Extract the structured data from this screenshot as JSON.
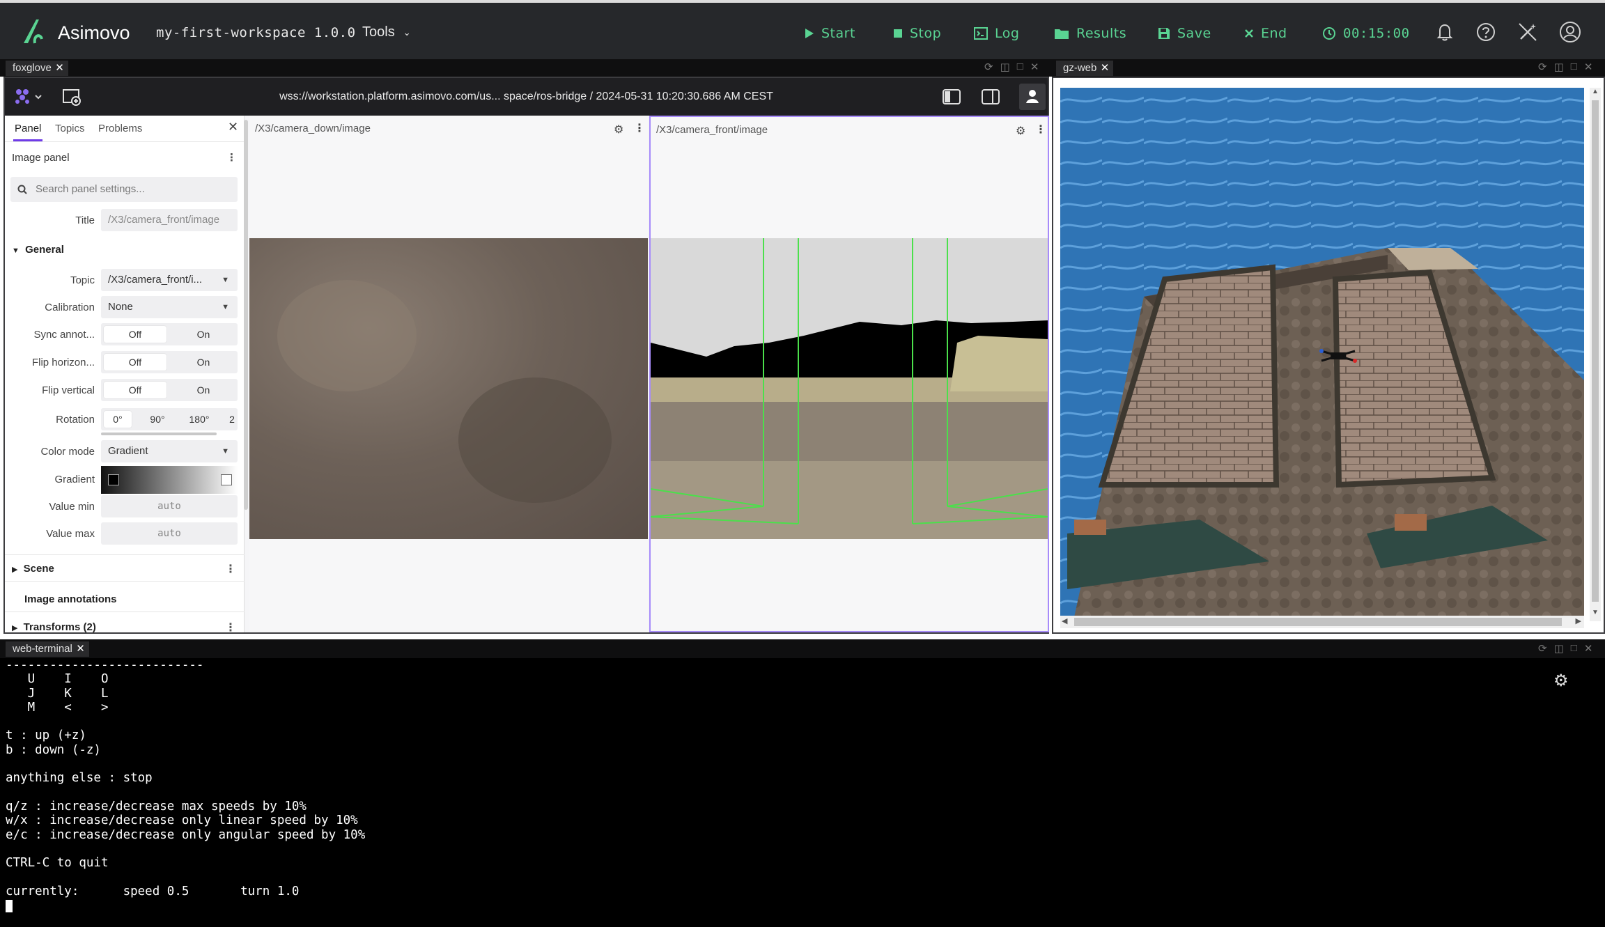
{
  "topbar": {
    "brand": "Asimovo",
    "workspace": "my-first-workspace 1.0.0",
    "tools_label": "Tools",
    "buttons": {
      "start": "Start",
      "stop": "Stop",
      "log": "Log",
      "results": "Results",
      "save": "Save",
      "end": "End"
    },
    "timer": "00:15:00",
    "accent": "#5ad493"
  },
  "foxglove": {
    "tab": "foxglove",
    "url": "wss://workstation.platform.asimovo.com/us... space/ros-bridge / 2024-05-31 10:20:30.686 AM CEST",
    "sidebar": {
      "tabs": [
        "Panel",
        "Topics",
        "Problems"
      ],
      "panel_title": "Image panel",
      "search_placeholder": "Search panel settings...",
      "title_label": "Title",
      "title_value": "/X3/camera_front/image",
      "general": "General",
      "topic_label": "Topic",
      "topic_value": "/X3/camera_front/i...",
      "calibration_label": "Calibration",
      "calibration_value": "None",
      "sync_label": "Sync annot...",
      "flip_h_label": "Flip horizon...",
      "flip_v_label": "Flip vertical",
      "off": "Off",
      "on": "On",
      "rotation_label": "Rotation",
      "rotations": [
        "0°",
        "90°",
        "180°",
        "2"
      ],
      "color_mode_label": "Color mode",
      "color_mode_value": "Gradient",
      "gradient_label": "Gradient",
      "value_min_label": "Value min",
      "value_max_label": "Value max",
      "auto": "auto",
      "scene": "Scene",
      "image_annotations": "Image annotations",
      "transforms": "Transforms (2)"
    },
    "panels": {
      "down": "/X3/camera_down/image",
      "front": "/X3/camera_front/image"
    }
  },
  "gzweb": {
    "tab": "gz-web"
  },
  "terminal": {
    "tab": "web-terminal",
    "lines": [
      "---------------------------",
      "   U    I    O",
      "   J    K    L",
      "   M    <    >",
      "",
      "t : up (+z)",
      "b : down (-z)",
      "",
      "anything else : stop",
      "",
      "q/z : increase/decrease max speeds by 10%",
      "w/x : increase/decrease only linear speed by 10%",
      "e/c : increase/decrease only angular speed by 10%",
      "",
      "CTRL-C to quit",
      "",
      "currently:      speed 0.5       turn 1.0"
    ]
  }
}
